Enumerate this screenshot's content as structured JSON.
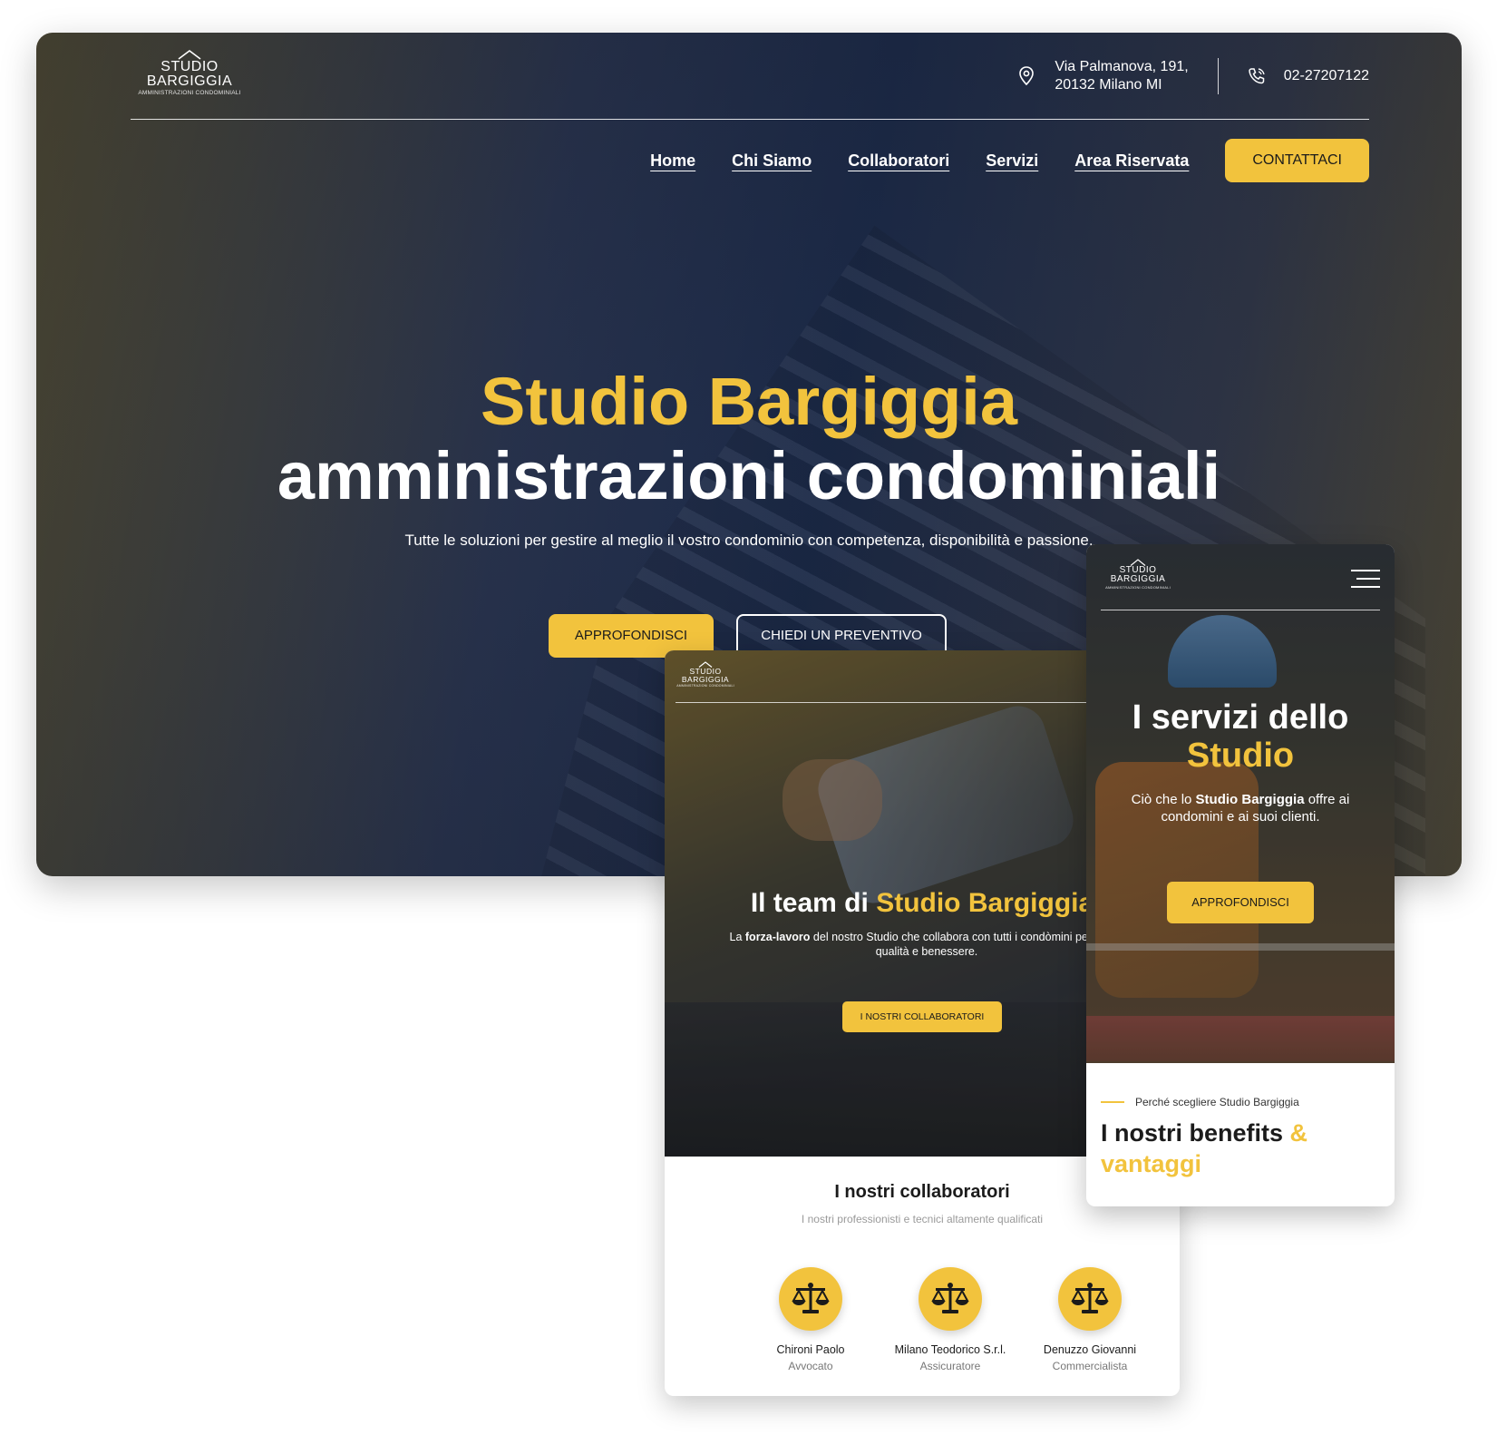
{
  "brand": {
    "line1": "STUDIO",
    "line2": "BARGIGGIA",
    "line3": "AMMINISTRAZIONI CONDOMINIALI"
  },
  "desktop": {
    "address_line1": "Via Palmanova, 191,",
    "address_line2": "20132 Milano MI",
    "phone": "02-27207122",
    "nav": [
      "Home",
      "Chi Siamo",
      "Collaboratori",
      "Servizi",
      "Area Riservata"
    ],
    "cta": "CONTATTACI",
    "title_line1": "Studio Bargiggia",
    "title_line2": "amministrazioni condominiali",
    "subtitle": "Tutte le soluzioni per gestire al meglio il vostro condominio con competenza, disponibilità e passione.",
    "button_primary": "APPROFONDISCI",
    "button_secondary": "CHIEDI UN PREVENTIVO"
  },
  "tablet": {
    "title_prefix": "Il team di ",
    "title_highlight": "Studio Bargiggia",
    "desc_line1_pre": "La ",
    "desc_line1_bold": "forza-lavoro",
    "desc_line1_post": " del nostro Studio che collabora con tutti i condòmini per garan",
    "desc_line2": "qualità e benessere.",
    "button": "I NOSTRI COLLABORATORI",
    "section_title": "I nostri collaboratori",
    "section_subtitle": "I nostri professionisti e tecnici altamente qualificati",
    "people": [
      {
        "name": "Chironi Paolo",
        "role": "Avvocato",
        "icon": "scales-icon"
      },
      {
        "name": "Milano Teodorico S.r.l.",
        "role": "Assicuratore",
        "icon": "scales-icon"
      },
      {
        "name": "Denuzzo Giovanni",
        "role": "Commercialista",
        "icon": "scales-icon"
      }
    ]
  },
  "mobile": {
    "title_line1": "I servizi dello",
    "title_line2": "Studio",
    "desc_pre": "Ciò che lo ",
    "desc_bold": "Studio Bargiggia",
    "desc_post": " offre ai",
    "desc_line2": "condomini e ai suoi clienti.",
    "button": "APPROFONDISCI",
    "kicker": "Perché scegliere Studio Bargiggia",
    "heading_pre": "I nostri benefits ",
    "heading_amp": "&",
    "heading_line2": "vantaggi"
  },
  "colors": {
    "accent": "#f2c33d",
    "dark": "#1b1b1b",
    "white": "#ffffff"
  }
}
